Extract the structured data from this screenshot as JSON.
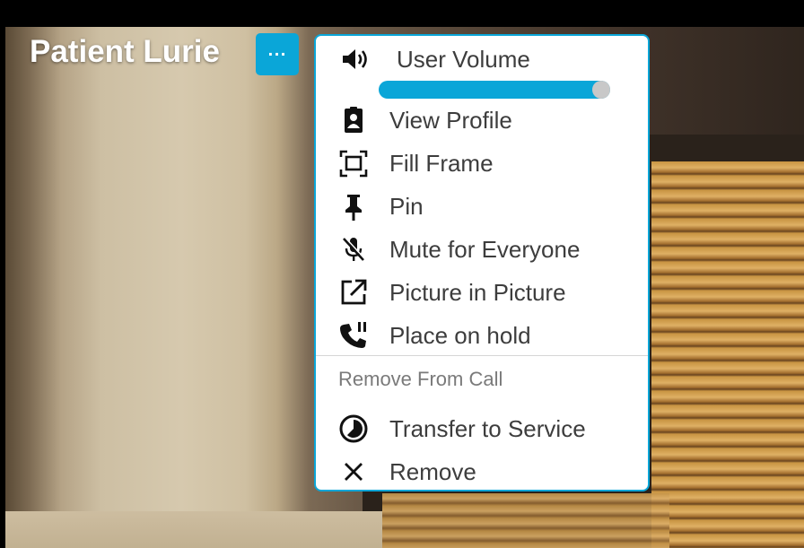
{
  "participant": {
    "name": "Patient Lurie",
    "more_button_glyph": "···"
  },
  "menu": {
    "volume": {
      "label": "User Volume",
      "level_percent": 100,
      "icon": "volume-icon"
    },
    "items": [
      {
        "label": "View Profile",
        "icon": "badge-icon"
      },
      {
        "label": "Fill Frame",
        "icon": "fill-frame-icon"
      },
      {
        "label": "Pin",
        "icon": "pin-icon"
      },
      {
        "label": "Mute for Everyone",
        "icon": "mic-off-icon"
      },
      {
        "label": "Picture in Picture",
        "icon": "open-external-icon"
      },
      {
        "label": "Place on hold",
        "icon": "phone-hold-icon"
      }
    ],
    "section_header": "Remove From Call",
    "remove_items": [
      {
        "label": "Transfer to Service",
        "icon": "transfer-icon"
      },
      {
        "label": "Remove",
        "icon": "close-icon"
      }
    ]
  },
  "colors": {
    "accent": "#0aa6d8",
    "text": "#3d3d3d",
    "muted": "#7a7a7a"
  }
}
